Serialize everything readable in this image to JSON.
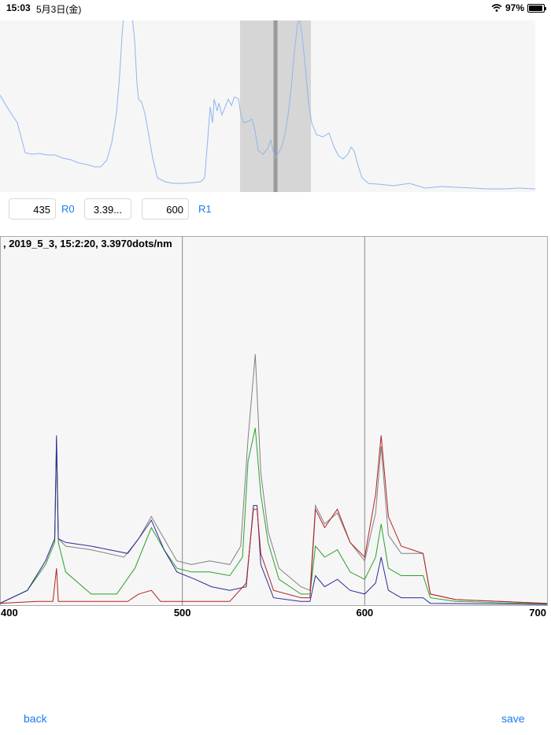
{
  "status_bar": {
    "time": "15:03",
    "date": "5月3日(金)",
    "battery": "97%",
    "icons": [
      "wifi-icon",
      "battery-icon"
    ]
  },
  "controls": {
    "r0_value": "435",
    "r0_label": "R0",
    "scale_value": "3.39...",
    "r1_value": "600",
    "r1_label": "R1"
  },
  "chart_data": {
    "type": "line",
    "title": ", 2019_5_3, 15:2:20, 3.3970dots/nm",
    "xlabel": "",
    "ylabel": "",
    "xlim": [
      400,
      700
    ],
    "ylim": [
      0,
      1
    ],
    "x_ticks": [
      400,
      500,
      600,
      700
    ],
    "grid": "vertical",
    "series": [
      {
        "color": "#808080",
        "points": [
          [
            400,
            0.005
          ],
          [
            415,
            0.04
          ],
          [
            425,
            0.12
          ],
          [
            430,
            0.18
          ],
          [
            431,
            0.45
          ],
          [
            432,
            0.18
          ],
          [
            436,
            0.16
          ],
          [
            450,
            0.15
          ],
          [
            468,
            0.13
          ],
          [
            476,
            0.18
          ],
          [
            483,
            0.24
          ],
          [
            490,
            0.18
          ],
          [
            497,
            0.12
          ],
          [
            505,
            0.11
          ],
          [
            515,
            0.12
          ],
          [
            526,
            0.11
          ],
          [
            532,
            0.16
          ],
          [
            536,
            0.45
          ],
          [
            540,
            0.68
          ],
          [
            543,
            0.36
          ],
          [
            547,
            0.2
          ],
          [
            553,
            0.1
          ],
          [
            565,
            0.05
          ],
          [
            570,
            0.04
          ],
          [
            573,
            0.27
          ],
          [
            578,
            0.22
          ],
          [
            585,
            0.25
          ],
          [
            592,
            0.17
          ],
          [
            600,
            0.12
          ],
          [
            606,
            0.25
          ],
          [
            609,
            0.43
          ],
          [
            613,
            0.19
          ],
          [
            620,
            0.14
          ],
          [
            632,
            0.14
          ],
          [
            636,
            0.03
          ],
          [
            650,
            0.015
          ],
          [
            700,
            0.005
          ]
        ]
      },
      {
        "color": "#2ca02c",
        "points": [
          [
            400,
            0.005
          ],
          [
            415,
            0.04
          ],
          [
            425,
            0.11
          ],
          [
            430,
            0.17
          ],
          [
            431,
            0.44
          ],
          [
            432,
            0.17
          ],
          [
            436,
            0.09
          ],
          [
            450,
            0.03
          ],
          [
            464,
            0.03
          ],
          [
            474,
            0.1
          ],
          [
            483,
            0.21
          ],
          [
            490,
            0.15
          ],
          [
            497,
            0.1
          ],
          [
            505,
            0.09
          ],
          [
            515,
            0.09
          ],
          [
            526,
            0.08
          ],
          [
            533,
            0.13
          ],
          [
            536,
            0.39
          ],
          [
            540,
            0.48
          ],
          [
            543,
            0.3
          ],
          [
            547,
            0.17
          ],
          [
            553,
            0.07
          ],
          [
            565,
            0.03
          ],
          [
            570,
            0.03
          ],
          [
            573,
            0.16
          ],
          [
            578,
            0.13
          ],
          [
            585,
            0.15
          ],
          [
            592,
            0.09
          ],
          [
            600,
            0.07
          ],
          [
            606,
            0.13
          ],
          [
            609,
            0.22
          ],
          [
            613,
            0.1
          ],
          [
            620,
            0.08
          ],
          [
            632,
            0.08
          ],
          [
            636,
            0.02
          ],
          [
            650,
            0.01
          ],
          [
            700,
            0.003
          ]
        ]
      },
      {
        "color": "#2b2b9a",
        "points": [
          [
            400,
            0.005
          ],
          [
            415,
            0.04
          ],
          [
            425,
            0.12
          ],
          [
            430,
            0.18
          ],
          [
            431,
            0.46
          ],
          [
            432,
            0.18
          ],
          [
            436,
            0.17
          ],
          [
            450,
            0.16
          ],
          [
            470,
            0.14
          ],
          [
            476,
            0.18
          ],
          [
            483,
            0.23
          ],
          [
            490,
            0.15
          ],
          [
            497,
            0.09
          ],
          [
            507,
            0.07
          ],
          [
            516,
            0.05
          ],
          [
            526,
            0.04
          ],
          [
            535,
            0.05
          ],
          [
            539,
            0.27
          ],
          [
            541,
            0.27
          ],
          [
            543,
            0.11
          ],
          [
            550,
            0.02
          ],
          [
            565,
            0.01
          ],
          [
            570,
            0.01
          ],
          [
            573,
            0.08
          ],
          [
            578,
            0.05
          ],
          [
            585,
            0.07
          ],
          [
            592,
            0.04
          ],
          [
            600,
            0.03
          ],
          [
            606,
            0.06
          ],
          [
            609,
            0.13
          ],
          [
            613,
            0.04
          ],
          [
            620,
            0.02
          ],
          [
            632,
            0.02
          ],
          [
            636,
            0.005
          ],
          [
            700,
            0.002
          ]
        ]
      },
      {
        "color": "#b22222",
        "points": [
          [
            400,
            0.005
          ],
          [
            420,
            0.01
          ],
          [
            429,
            0.01
          ],
          [
            431,
            0.1
          ],
          [
            432,
            0.01
          ],
          [
            450,
            0.01
          ],
          [
            470,
            0.01
          ],
          [
            476,
            0.03
          ],
          [
            483,
            0.04
          ],
          [
            488,
            0.01
          ],
          [
            497,
            0.01
          ],
          [
            526,
            0.01
          ],
          [
            535,
            0.06
          ],
          [
            539,
            0.26
          ],
          [
            541,
            0.26
          ],
          [
            543,
            0.14
          ],
          [
            550,
            0.04
          ],
          [
            565,
            0.02
          ],
          [
            570,
            0.02
          ],
          [
            573,
            0.26
          ],
          [
            578,
            0.21
          ],
          [
            585,
            0.26
          ],
          [
            592,
            0.17
          ],
          [
            600,
            0.13
          ],
          [
            606,
            0.3
          ],
          [
            609,
            0.46
          ],
          [
            613,
            0.24
          ],
          [
            620,
            0.16
          ],
          [
            632,
            0.14
          ],
          [
            636,
            0.03
          ],
          [
            650,
            0.015
          ],
          [
            700,
            0.005
          ]
        ]
      }
    ]
  },
  "preview_data": {
    "x_domain": [
      0,
      680
    ],
    "y_domain": [
      0,
      218
    ],
    "selection_range": [
      305,
      395
    ],
    "cursor_x": 350
  },
  "nav": {
    "back_label": "back",
    "save_label": "save"
  }
}
